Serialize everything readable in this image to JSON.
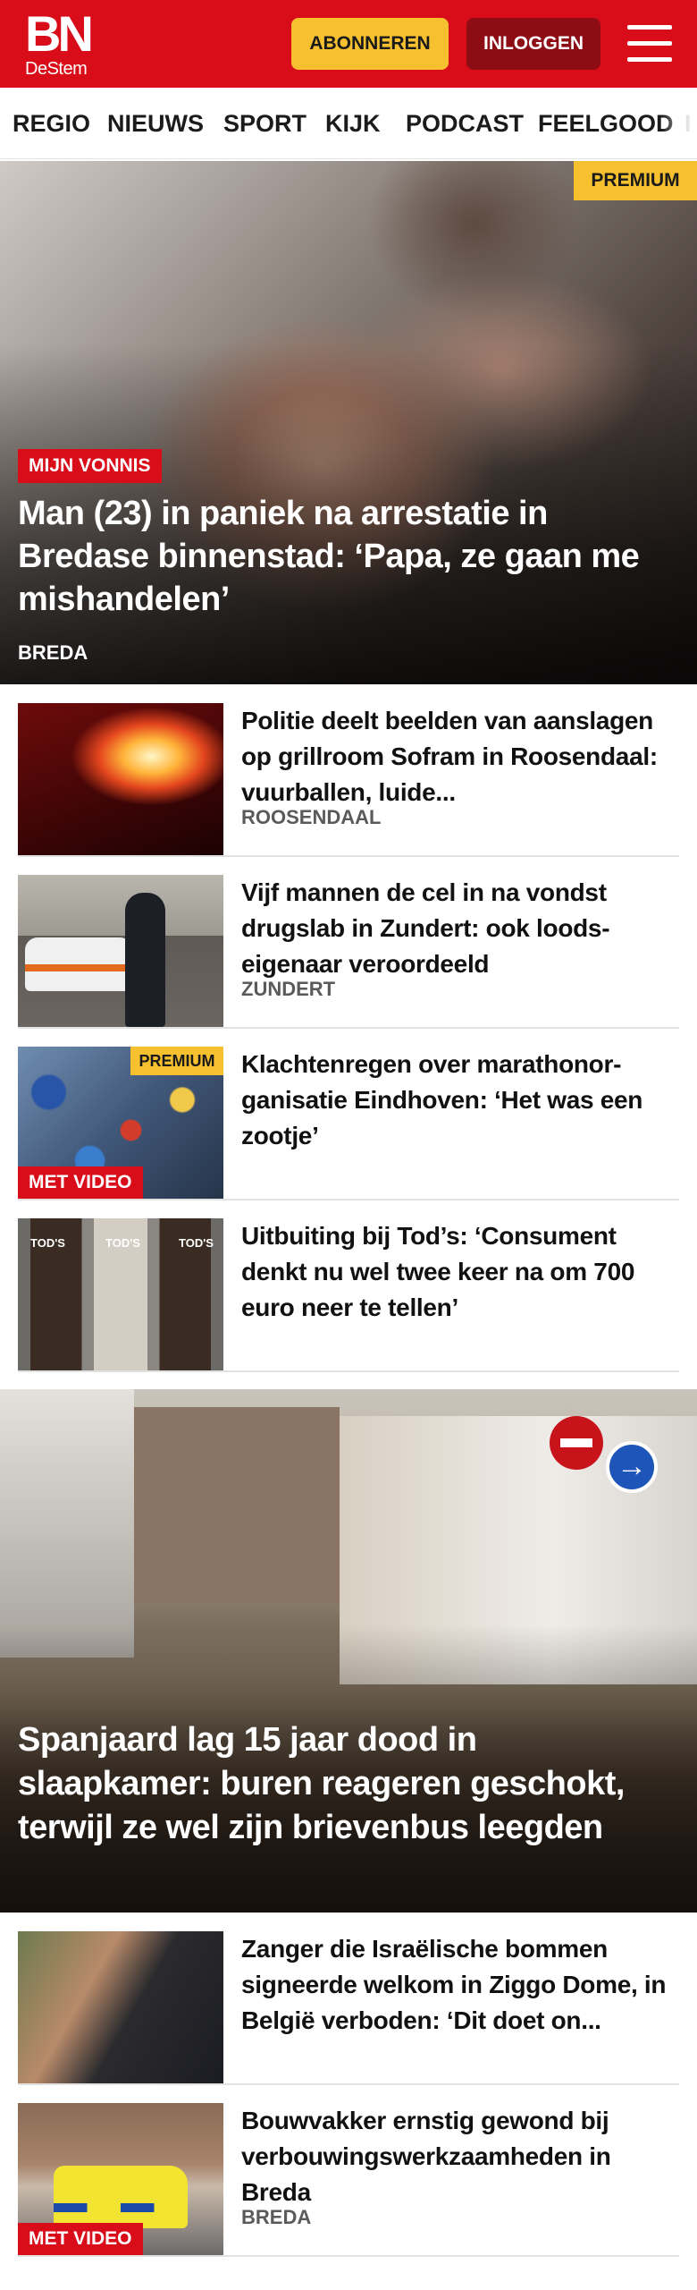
{
  "header": {
    "logo_main": "BN",
    "logo_sub": "DeStem",
    "subscribe_label": "ABONNEREN",
    "login_label": "INLOGGEN",
    "menu_icon": "hamburger-menu-icon",
    "brand_color": "#d80d19",
    "accent_color": "#f6c02e"
  },
  "nav": {
    "items": [
      "REGIO",
      "NIEUWS",
      "SPORT",
      "KIJK",
      "PODCAST",
      "FEELGOOD",
      "I"
    ]
  },
  "hero": {
    "badge": "PREMIUM",
    "label": "MIJN VONNIS",
    "title": "Man (23) in paniek na arrestatie in Bredase binnenstad: ‘Papa, ze gaan me mishandelen’",
    "location": "BREDA"
  },
  "articles": [
    {
      "title": "Politie deelt beelden van aanslagen op grillroom Sofram in Roosendaal: vuurballen, luide...",
      "location": "ROOSENDAAL"
    },
    {
      "title": "Vijf mannen de cel in na vondst drugslab in Zundert: ook loods-eigenaar veroordeeld",
      "location": "ZUNDERT"
    },
    {
      "title": "Klachtenregen over marathonor-ganisatie Eindhoven: ‘Het was een zootje’",
      "badge": "PREMIUM",
      "video_label": "MET VIDEO"
    },
    {
      "title": "Uitbuiting bij Tod’s: ‘Consument denkt nu wel twee keer na om 700 euro neer te tellen’",
      "shop_sign": "TOD'S"
    }
  ],
  "feature": {
    "title": "Spanjaard lag 15 jaar dood in slaapkamer: buren reageren geschokt, terwijl ze wel zijn brievenbus leegden"
  },
  "articles_bottom": [
    {
      "title": "Zanger die Israëlische bommen signeerde welkom in Ziggo Dome, in België verboden: ‘Dit doet on..."
    },
    {
      "title": "Bouwvakker ernstig gewond bij verbouwingswerkzaamheden in Breda",
      "location": "BREDA",
      "video_label": "MET VIDEO"
    }
  ]
}
